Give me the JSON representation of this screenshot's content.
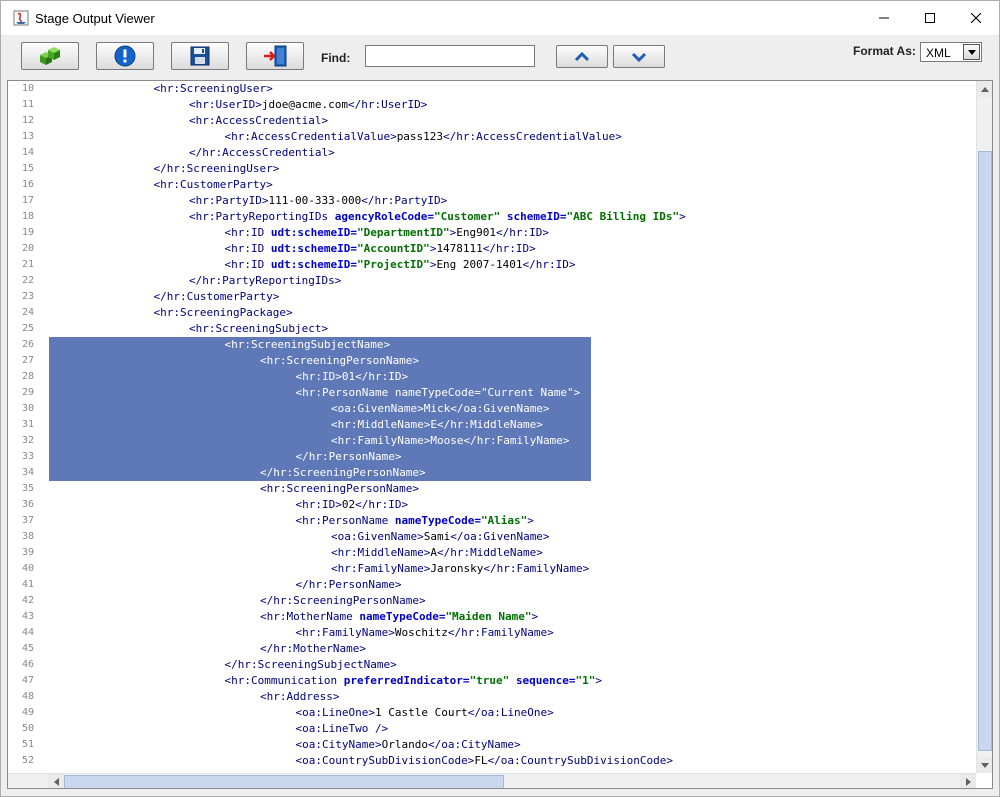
{
  "window": {
    "title": "Stage Output Viewer"
  },
  "toolbar": {
    "find_label": "Find:",
    "find_value": "",
    "format_label": "Format As:",
    "format_value": "XML"
  },
  "lines": [
    {
      "n": "10",
      "indent": 3,
      "tokens": [
        [
          "t",
          "<hr:ScreeningUser>"
        ]
      ]
    },
    {
      "n": "11",
      "indent": 4,
      "tokens": [
        [
          "t",
          "<hr:UserID>"
        ],
        [
          "x",
          "jdoe@acme.com"
        ],
        [
          "t",
          "</hr:UserID>"
        ]
      ]
    },
    {
      "n": "12",
      "indent": 4,
      "tokens": [
        [
          "t",
          "<hr:AccessCredential>"
        ]
      ]
    },
    {
      "n": "13",
      "indent": 5,
      "tokens": [
        [
          "t",
          "<hr:AccessCredentialValue>"
        ],
        [
          "x",
          "pass123"
        ],
        [
          "t",
          "</hr:AccessCredentialValue>"
        ]
      ]
    },
    {
      "n": "14",
      "indent": 4,
      "tokens": [
        [
          "t",
          "</hr:AccessCredential>"
        ]
      ]
    },
    {
      "n": "15",
      "indent": 3,
      "tokens": [
        [
          "t",
          "</hr:ScreeningUser>"
        ]
      ]
    },
    {
      "n": "16",
      "indent": 3,
      "tokens": [
        [
          "t",
          "<hr:CustomerParty>"
        ]
      ]
    },
    {
      "n": "17",
      "indent": 4,
      "tokens": [
        [
          "t",
          "<hr:PartyID>"
        ],
        [
          "x",
          "111-00-333-000"
        ],
        [
          "t",
          "</hr:PartyID>"
        ]
      ]
    },
    {
      "n": "18",
      "indent": 4,
      "tokens": [
        [
          "t",
          "<hr:PartyReportingIDs "
        ],
        [
          "a",
          "agencyRoleCode="
        ],
        [
          "v",
          "\"Customer\""
        ],
        [
          "x",
          " "
        ],
        [
          "a",
          "schemeID="
        ],
        [
          "v",
          "\"ABC Billing IDs\""
        ],
        [
          "t",
          ">"
        ]
      ]
    },
    {
      "n": "19",
      "indent": 5,
      "tokens": [
        [
          "t",
          "<hr:ID "
        ],
        [
          "a",
          "udt:schemeID="
        ],
        [
          "v",
          "\"DepartmentID\""
        ],
        [
          "t",
          ">"
        ],
        [
          "x",
          "Eng901"
        ],
        [
          "t",
          "</hr:ID>"
        ]
      ]
    },
    {
      "n": "20",
      "indent": 5,
      "tokens": [
        [
          "t",
          "<hr:ID "
        ],
        [
          "a",
          "udt:schemeID="
        ],
        [
          "v",
          "\"AccountID\""
        ],
        [
          "t",
          ">"
        ],
        [
          "x",
          "1478111"
        ],
        [
          "t",
          "</hr:ID>"
        ]
      ]
    },
    {
      "n": "21",
      "indent": 5,
      "tokens": [
        [
          "t",
          "<hr:ID "
        ],
        [
          "a",
          "udt:schemeID="
        ],
        [
          "v",
          "\"ProjectID\""
        ],
        [
          "t",
          ">"
        ],
        [
          "x",
          "Eng 2007-1401"
        ],
        [
          "t",
          "</hr:ID>"
        ]
      ]
    },
    {
      "n": "22",
      "indent": 4,
      "tokens": [
        [
          "t",
          "</hr:PartyReportingIDs>"
        ]
      ]
    },
    {
      "n": "23",
      "indent": 3,
      "tokens": [
        [
          "t",
          "</hr:CustomerParty>"
        ]
      ]
    },
    {
      "n": "24",
      "indent": 3,
      "tokens": [
        [
          "t",
          "<hr:ScreeningPackage>"
        ]
      ]
    },
    {
      "n": "25",
      "indent": 4,
      "tokens": [
        [
          "t",
          "<hr:ScreeningSubject>"
        ]
      ]
    },
    {
      "n": "26",
      "indent": 5,
      "sel": true,
      "tokens": [
        [
          "t",
          "<hr:ScreeningSubjectName>"
        ]
      ]
    },
    {
      "n": "27",
      "indent": 6,
      "sel": true,
      "tokens": [
        [
          "t",
          "<hr:ScreeningPersonName>"
        ]
      ]
    },
    {
      "n": "28",
      "indent": 7,
      "sel": true,
      "tokens": [
        [
          "t",
          "<hr:ID>"
        ],
        [
          "x",
          "01"
        ],
        [
          "t",
          "</hr:ID>"
        ]
      ]
    },
    {
      "n": "29",
      "indent": 7,
      "sel": true,
      "tokens": [
        [
          "t",
          "<hr:PersonName "
        ],
        [
          "a",
          "nameTypeCode="
        ],
        [
          "v",
          "\"Current Name\""
        ],
        [
          "t",
          ">"
        ]
      ]
    },
    {
      "n": "30",
      "indent": 8,
      "sel": true,
      "tokens": [
        [
          "t",
          "<oa:GivenName>"
        ],
        [
          "x",
          "Mick"
        ],
        [
          "t",
          "</oa:GivenName>"
        ]
      ]
    },
    {
      "n": "31",
      "indent": 8,
      "sel": true,
      "tokens": [
        [
          "t",
          "<hr:MiddleName>"
        ],
        [
          "x",
          "E"
        ],
        [
          "t",
          "</hr:MiddleName>"
        ]
      ]
    },
    {
      "n": "32",
      "indent": 8,
      "sel": true,
      "tokens": [
        [
          "t",
          "<hr:FamilyName>"
        ],
        [
          "x",
          "Moose"
        ],
        [
          "t",
          "</hr:FamilyName>"
        ]
      ]
    },
    {
      "n": "33",
      "indent": 7,
      "sel": true,
      "tokens": [
        [
          "t",
          "</hr:PersonName>"
        ]
      ]
    },
    {
      "n": "34",
      "indent": 6,
      "sel": true,
      "tokens": [
        [
          "t",
          "</hr:ScreeningPersonName>"
        ]
      ]
    },
    {
      "n": "35",
      "indent": 6,
      "tokens": [
        [
          "t",
          "<hr:ScreeningPersonName>"
        ]
      ]
    },
    {
      "n": "36",
      "indent": 7,
      "tokens": [
        [
          "t",
          "<hr:ID>"
        ],
        [
          "x",
          "02"
        ],
        [
          "t",
          "</hr:ID>"
        ]
      ]
    },
    {
      "n": "37",
      "indent": 7,
      "tokens": [
        [
          "t",
          "<hr:PersonName "
        ],
        [
          "a",
          "nameTypeCode="
        ],
        [
          "v",
          "\"Alias\""
        ],
        [
          "t",
          ">"
        ]
      ]
    },
    {
      "n": "38",
      "indent": 8,
      "tokens": [
        [
          "t",
          "<oa:GivenName>"
        ],
        [
          "x",
          "Sami"
        ],
        [
          "t",
          "</oa:GivenName>"
        ]
      ]
    },
    {
      "n": "39",
      "indent": 8,
      "tokens": [
        [
          "t",
          "<hr:MiddleName>"
        ],
        [
          "x",
          "A"
        ],
        [
          "t",
          "</hr:MiddleName>"
        ]
      ]
    },
    {
      "n": "40",
      "indent": 8,
      "tokens": [
        [
          "t",
          "<hr:FamilyName>"
        ],
        [
          "x",
          "Jaronsky"
        ],
        [
          "t",
          "</hr:FamilyName>"
        ]
      ]
    },
    {
      "n": "41",
      "indent": 7,
      "tokens": [
        [
          "t",
          "</hr:PersonName>"
        ]
      ]
    },
    {
      "n": "42",
      "indent": 6,
      "tokens": [
        [
          "t",
          "</hr:ScreeningPersonName>"
        ]
      ]
    },
    {
      "n": "43",
      "indent": 6,
      "tokens": [
        [
          "t",
          "<hr:MotherName "
        ],
        [
          "a",
          "nameTypeCode="
        ],
        [
          "v",
          "\"Maiden Name\""
        ],
        [
          "t",
          ">"
        ]
      ]
    },
    {
      "n": "44",
      "indent": 7,
      "tokens": [
        [
          "t",
          "<hr:FamilyName>"
        ],
        [
          "x",
          "Woschitz"
        ],
        [
          "t",
          "</hr:FamilyName>"
        ]
      ]
    },
    {
      "n": "45",
      "indent": 6,
      "tokens": [
        [
          "t",
          "</hr:MotherName>"
        ]
      ]
    },
    {
      "n": "46",
      "indent": 5,
      "tokens": [
        [
          "t",
          "</hr:ScreeningSubjectName>"
        ]
      ]
    },
    {
      "n": "47",
      "indent": 5,
      "tokens": [
        [
          "t",
          "<hr:Communication "
        ],
        [
          "a",
          "preferredIndicator="
        ],
        [
          "v",
          "\"true\""
        ],
        [
          "x",
          " "
        ],
        [
          "a",
          "sequence="
        ],
        [
          "v",
          "\"1\""
        ],
        [
          "t",
          ">"
        ]
      ]
    },
    {
      "n": "48",
      "indent": 6,
      "tokens": [
        [
          "t",
          "<hr:Address>"
        ]
      ]
    },
    {
      "n": "49",
      "indent": 7,
      "tokens": [
        [
          "t",
          "<oa:LineOne>"
        ],
        [
          "x",
          "1 Castle Court"
        ],
        [
          "t",
          "</oa:LineOne>"
        ]
      ]
    },
    {
      "n": "50",
      "indent": 7,
      "tokens": [
        [
          "t",
          "<oa:LineTwo />"
        ]
      ]
    },
    {
      "n": "51",
      "indent": 7,
      "tokens": [
        [
          "t",
          "<oa:CityName>"
        ],
        [
          "x",
          "Orlando"
        ],
        [
          "t",
          "</oa:CityName>"
        ]
      ]
    },
    {
      "n": "52",
      "indent": 7,
      "tokens": [
        [
          "t",
          "<oa:CountrySubDivisionCode>"
        ],
        [
          "x",
          "FL"
        ],
        [
          "t",
          "</oa:CountrySubDivisionCode>"
        ]
      ]
    }
  ]
}
